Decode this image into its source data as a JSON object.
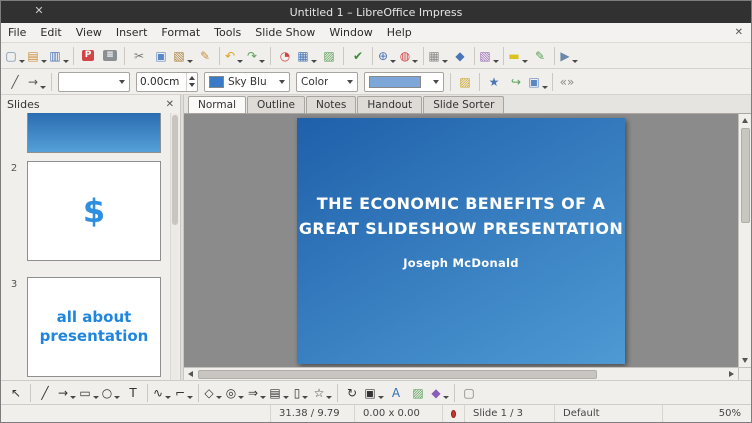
{
  "window": {
    "title": "Untitled 1 – LibreOffice Impress",
    "close_glyph": "✕"
  },
  "menubar": {
    "items": [
      "File",
      "Edit",
      "View",
      "Insert",
      "Format",
      "Tools",
      "Slide Show",
      "Window",
      "Help"
    ],
    "close_glyph": "✕"
  },
  "toolbar_main": {
    "icons": [
      {
        "name": "new-document",
        "glyph": "▢",
        "fg": "#6b88a8",
        "dd": true
      },
      {
        "name": "open",
        "glyph": "▤",
        "fg": "#c98f3d",
        "dd": true
      },
      {
        "name": "save",
        "glyph": "▥",
        "fg": "#4a76b8",
        "dd": true
      },
      {
        "sep": true
      },
      {
        "name": "export-pdf",
        "glyph": "P",
        "fg": "#ffffff",
        "bg": "#d04545"
      },
      {
        "name": "print",
        "glyph": "≡",
        "fg": "#ffffff",
        "bg": "#8a8f94"
      },
      {
        "sep": true
      },
      {
        "name": "cut",
        "glyph": "✂",
        "fg": "#7a7a7a"
      },
      {
        "name": "copy",
        "glyph": "▣",
        "fg": "#5b87c7"
      },
      {
        "name": "paste",
        "glyph": "▧",
        "fg": "#a8803d",
        "dd": true
      },
      {
        "name": "clone-formatting",
        "glyph": "✎",
        "fg": "#c98f3d"
      },
      {
        "sep": true
      },
      {
        "name": "undo",
        "glyph": "↶",
        "fg": "#d9a41e",
        "dd": true
      },
      {
        "name": "redo",
        "glyph": "↷",
        "fg": "#58a058",
        "dd": true
      },
      {
        "sep": true
      },
      {
        "name": "insert-chart",
        "glyph": "◔",
        "fg": "#d04545"
      },
      {
        "name": "insert-table",
        "glyph": "▦",
        "fg": "#4a76b8",
        "dd": true
      },
      {
        "name": "insert-image",
        "glyph": "▨",
        "fg": "#58a058"
      },
      {
        "sep": true
      },
      {
        "name": "spelling",
        "glyph": "✔",
        "fg": "#3c8a3c"
      },
      {
        "sep": true
      },
      {
        "name": "zoom",
        "glyph": "⊕",
        "fg": "#4a76b8",
        "dd": true
      },
      {
        "name": "help-lifebuoy",
        "glyph": "◍",
        "fg": "#d04545",
        "dd": true
      },
      {
        "sep": true
      },
      {
        "name": "display-grid",
        "glyph": "▦",
        "fg": "#8a8a8a",
        "dd": true
      },
      {
        "name": "navigator",
        "glyph": "◆",
        "fg": "#4a76b8"
      },
      {
        "sep": true
      },
      {
        "name": "gallery",
        "glyph": "▧",
        "fg": "#9a6ab8",
        "dd": true
      },
      {
        "sep": true
      },
      {
        "name": "insert-comment",
        "glyph": "▬",
        "fg": "#d9c41e",
        "dd": true
      },
      {
        "name": "draw-functions",
        "glyph": "✎",
        "fg": "#58a058"
      },
      {
        "sep": true
      },
      {
        "name": "start-presentation",
        "glyph": "▶",
        "fg": "#6b88a8",
        "dd": true
      }
    ]
  },
  "toolbar_line": {
    "left_icons": [
      {
        "name": "line",
        "glyph": "╱",
        "fg": "#555555"
      },
      {
        "name": "arrow-style",
        "glyph": "→",
        "fg": "#555555",
        "dd": true
      }
    ],
    "line_width": "0.00cm",
    "line_color_label": "Sky Blu",
    "line_color_hex": "#3a7bc8",
    "fill_style_label": "Color",
    "fill_color_hex": "#7da7d8",
    "right_icons": [
      {
        "name": "shadow",
        "glyph": "▨",
        "fg": "#c9a227"
      },
      {
        "sep": true
      },
      {
        "name": "animation-effects",
        "glyph": "★",
        "fg": "#4a76b8"
      },
      {
        "name": "interaction",
        "glyph": "↪",
        "fg": "#58a058"
      },
      {
        "name": "arrange",
        "glyph": "▣",
        "fg": "#5b87c7",
        "dd": true
      },
      {
        "sep": true
      },
      {
        "name": "helplines",
        "glyph": "«»",
        "fg": "#8a8a8a"
      }
    ]
  },
  "slides_panel": {
    "title": "Slides",
    "close_glyph": "✕",
    "slide1_gradient": {
      "from": "#2a6cb2",
      "to": "#55a0d8",
      "angle": 180
    },
    "slides": [
      {
        "number": "2",
        "content": "$"
      },
      {
        "number": "3",
        "content": "all about presentation"
      }
    ]
  },
  "view": {
    "tabs": [
      "Normal",
      "Outline",
      "Notes",
      "Handout",
      "Slide Sorter"
    ],
    "active_index": 0
  },
  "slide": {
    "gradient": {
      "from": "#1f60aa",
      "to": "#4e9ad4",
      "angle": 150
    },
    "title_line1": "THE ECONOMIC BENEFITS OF A",
    "title_line2": "GREAT SLIDESHOW PRESENTATION",
    "subtitle": "Joseph McDonald"
  },
  "drawing_toolbar": {
    "icons": [
      {
        "name": "select",
        "glyph": "↖",
        "fg": "#333333"
      },
      {
        "sep": true
      },
      {
        "name": "insert-line",
        "glyph": "╱",
        "fg": "#333333"
      },
      {
        "name": "lines-and-arrows",
        "glyph": "→",
        "fg": "#333333",
        "dd": true
      },
      {
        "name": "rectangle",
        "glyph": "▭",
        "fg": "#333333",
        "dd": true
      },
      {
        "name": "ellipse",
        "glyph": "○",
        "fg": "#333333",
        "dd": true
      },
      {
        "name": "insert-textbox",
        "glyph": "T",
        "fg": "#333333"
      },
      {
        "sep": true
      },
      {
        "name": "curves-polygons",
        "glyph": "∿",
        "fg": "#333333",
        "dd": true
      },
      {
        "name": "connectors",
        "glyph": "⌐",
        "fg": "#333333",
        "dd": true
      },
      {
        "sep": true
      },
      {
        "name": "basic-shapes",
        "glyph": "◇",
        "fg": "#333333",
        "dd": true
      },
      {
        "name": "symbol-shapes",
        "glyph": "◎",
        "fg": "#333333",
        "dd": true
      },
      {
        "name": "block-arrows",
        "glyph": "⇒",
        "fg": "#333333",
        "dd": true
      },
      {
        "name": "flowchart",
        "glyph": "▤",
        "fg": "#333333",
        "dd": true
      },
      {
        "name": "callouts",
        "glyph": "▯",
        "fg": "#333333",
        "dd": true
      },
      {
        "name": "stars-banners",
        "glyph": "☆",
        "fg": "#333333",
        "dd": true
      },
      {
        "sep": true
      },
      {
        "name": "rotate",
        "glyph": "↻",
        "fg": "#333333"
      },
      {
        "name": "align-objects",
        "glyph": "▣",
        "fg": "#333333",
        "dd": true
      },
      {
        "name": "fontwork",
        "glyph": "A",
        "fg": "#2d6fb8"
      },
      {
        "name": "insert-image-draw",
        "glyph": "▨",
        "fg": "#58a058"
      },
      {
        "name": "toggle-3d",
        "glyph": "◆",
        "fg": "#8a5db8",
        "dd": true
      },
      {
        "sep": true
      },
      {
        "name": "presentation-minimizer",
        "glyph": "▢",
        "fg": "#777777"
      }
    ]
  },
  "statusbar": {
    "position": "31.38 / 9.79",
    "size": "0.00 x 0.00",
    "slide_indicator": "Slide 1 / 3",
    "style_name": "Default",
    "zoom": "50%"
  }
}
